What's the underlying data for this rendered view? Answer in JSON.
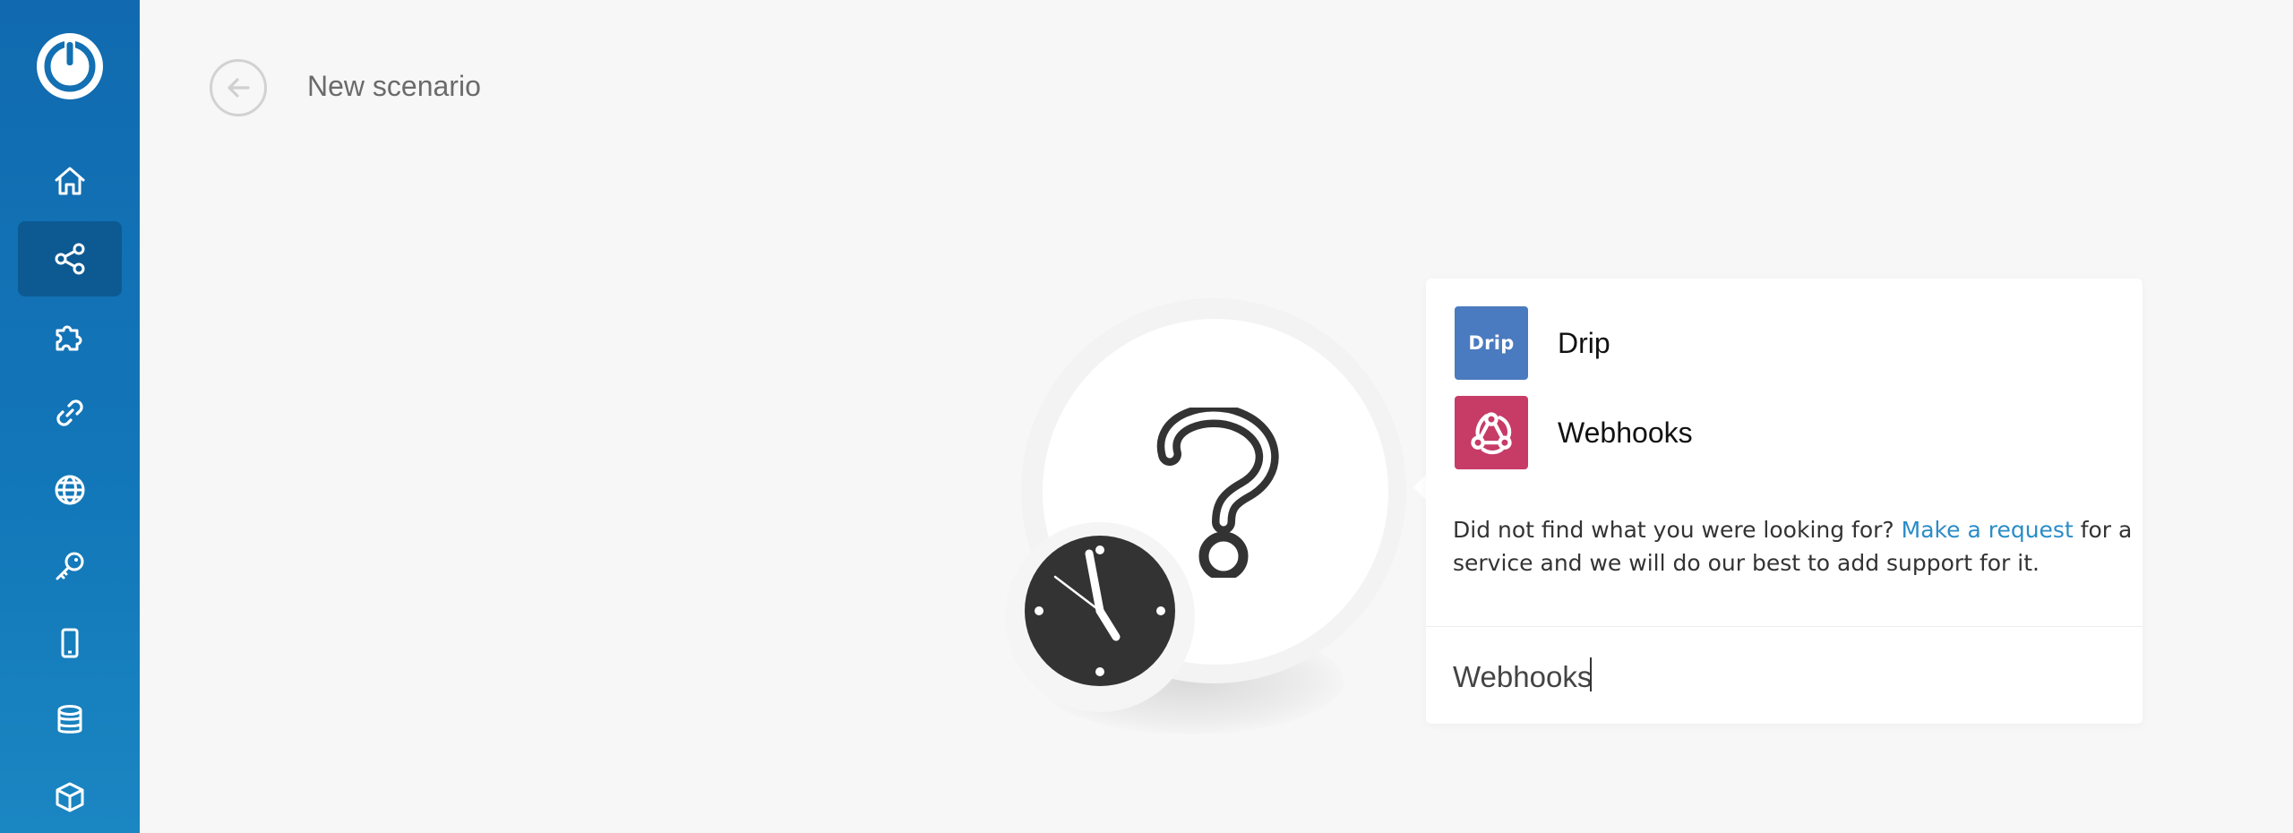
{
  "header": {
    "title": "New scenario"
  },
  "sidebar": {
    "items": [
      {
        "name": "home",
        "icon": "home-icon",
        "active": false
      },
      {
        "name": "scenarios",
        "icon": "share-icon",
        "active": true
      },
      {
        "name": "templates",
        "icon": "puzzle-icon",
        "active": false
      },
      {
        "name": "connections",
        "icon": "link-icon",
        "active": false
      },
      {
        "name": "webhooks",
        "icon": "globe-icon",
        "active": false
      },
      {
        "name": "keys",
        "icon": "key-icon",
        "active": false
      },
      {
        "name": "devices",
        "icon": "mobile-icon",
        "active": false
      },
      {
        "name": "data-stores",
        "icon": "database-icon",
        "active": false
      },
      {
        "name": "data-structures",
        "icon": "cube-icon",
        "active": false
      }
    ]
  },
  "module": {
    "icon": "question-mark-icon",
    "trigger_icon": "clock-icon"
  },
  "app_picker": {
    "results": [
      {
        "label": "Drip",
        "icon_text": "Drip",
        "color": "#4a7abf"
      },
      {
        "label": "Webhooks",
        "icon": "webhook-icon",
        "color": "#c73b67"
      }
    ],
    "help_before": "Did not find what you were looking for? ",
    "help_link": "Make a request",
    "help_after": " for a service and we will do our best to add support for it.",
    "search_value": "Webhooks"
  },
  "colors": {
    "sidebar": "#1270b3",
    "sidebar_active": "#0d5a92",
    "link": "#2a8cc8",
    "drip": "#4a7abf",
    "webhooks": "#c73b67"
  }
}
